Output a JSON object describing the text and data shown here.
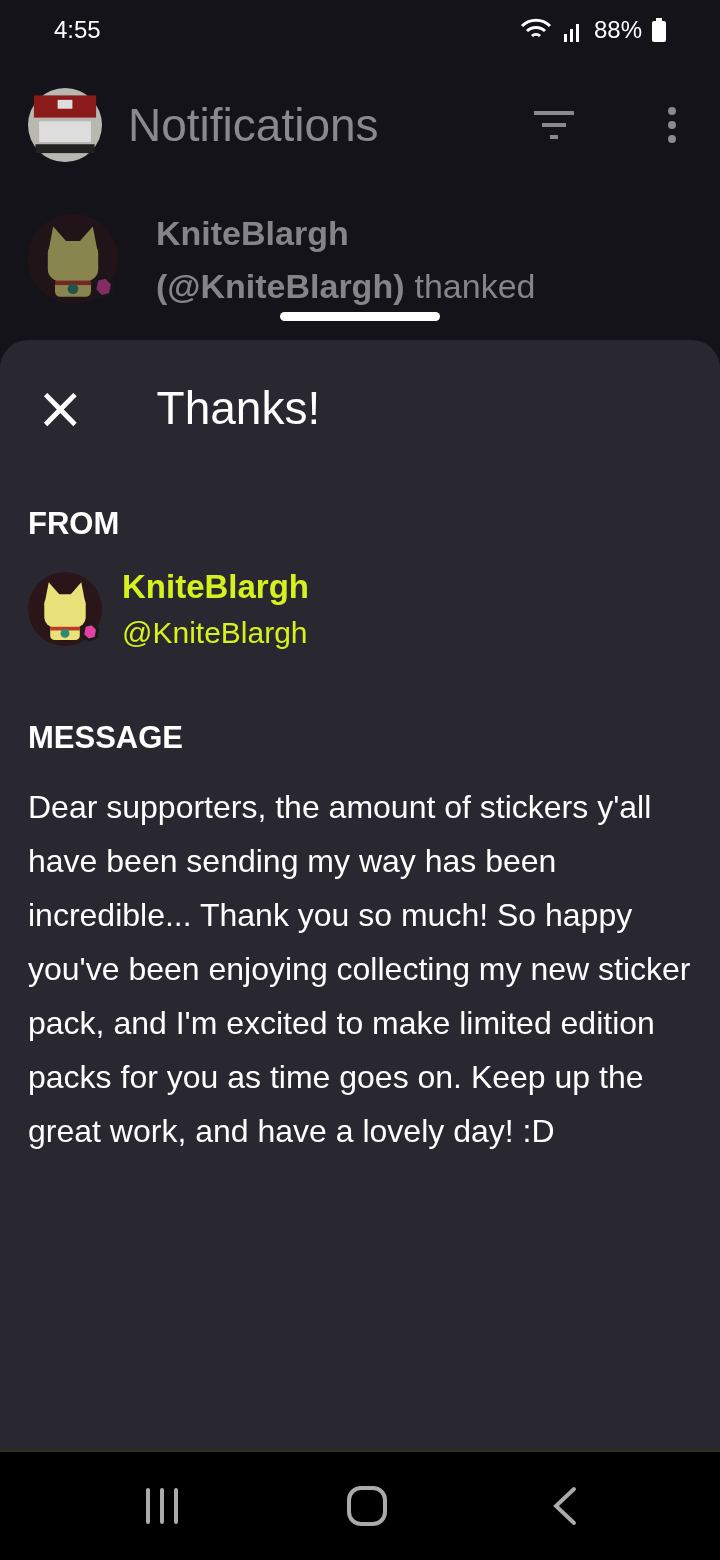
{
  "status_bar": {
    "time": "4:55",
    "battery": "88%"
  },
  "header": {
    "title": "Notifications"
  },
  "notification": {
    "name": "KniteBlargh",
    "handle": "(@KniteBlargh)",
    "text": "thanked"
  },
  "sheet": {
    "title": "Thanks!",
    "close": "×",
    "from_label": "FROM",
    "sender_name": "KniteBlargh",
    "sender_handle": "@KniteBlargh",
    "message_label": "MESSAGE",
    "message": "Dear supporters, the amount of stickers y'all have been sending my way has been incredible... Thank you so much! So happy you've been enjoying collecting my new sticker pack, and I'm excited to make limited edition packs for you as time goes on. Keep up the great work, and have a lovely day! :D"
  }
}
